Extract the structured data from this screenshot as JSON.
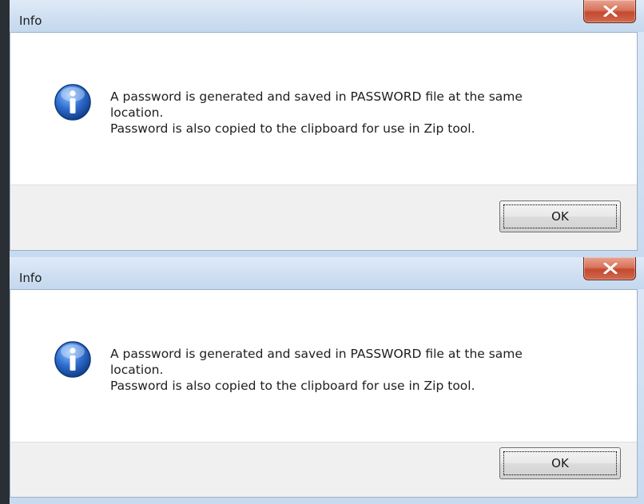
{
  "dialogs": [
    {
      "title": "Info",
      "message_lines": [
        "A password is generated and saved in PASSWORD file at the same",
        "location.",
        "Password is also copied to the clipboard for use in Zip tool."
      ],
      "ok_label": "OK",
      "icon": "info-icon",
      "close_icon": "close-icon"
    },
    {
      "title": "Info",
      "message_lines": [
        "A password is generated and saved in PASSWORD file at the same",
        "location.",
        "Password is also copied to the clipboard for use in Zip tool."
      ],
      "ok_label": "OK",
      "icon": "info-icon",
      "close_icon": "close-icon"
    }
  ],
  "colors": {
    "titlebar": "#cfdff1",
    "close_button": "#c24a30",
    "footer": "#f0f0f0",
    "info_icon": "#1f5fbf"
  }
}
